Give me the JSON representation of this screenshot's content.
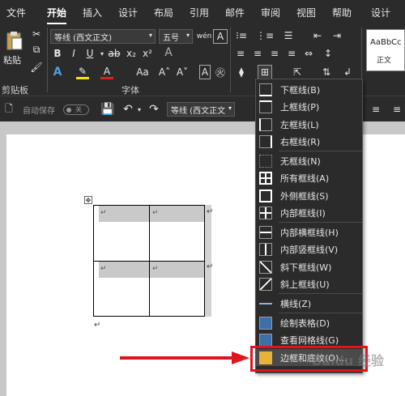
{
  "menubar": {
    "items": [
      "文件",
      "开始",
      "插入",
      "设计",
      "布局",
      "引用",
      "邮件",
      "审阅",
      "视图",
      "帮助",
      "设计"
    ],
    "active_index": 1
  },
  "ribbon": {
    "paste_label": "粘贴",
    "clipboard_label": "剪贴板",
    "font_group_label": "字体",
    "font_name": "等线 (西文正文)",
    "font_size": "五号",
    "style_preview": "AaBbCc",
    "style_name": "正文"
  },
  "qat": {
    "autosave_label": "自动保存",
    "autosave_state": "关",
    "font_name": "等线 (西文正文"
  },
  "dropdown": {
    "items": [
      {
        "label": "下框线(B)",
        "icon": "bottom-border-icon"
      },
      {
        "label": "上框线(P)",
        "icon": "top-border-icon"
      },
      {
        "label": "左框线(L)",
        "icon": "left-border-icon"
      },
      {
        "label": "右框线(R)",
        "icon": "right-border-icon"
      },
      {
        "label": "无框线(N)",
        "icon": "no-border-icon"
      },
      {
        "label": "所有框线(A)",
        "icon": "all-borders-icon"
      },
      {
        "label": "外侧框线(S)",
        "icon": "outside-borders-icon"
      },
      {
        "label": "内部框线(I)",
        "icon": "inside-borders-icon"
      },
      {
        "label": "内部横框线(H)",
        "icon": "inside-horizontal-border-icon"
      },
      {
        "label": "内部竖框线(V)",
        "icon": "inside-vertical-border-icon"
      },
      {
        "label": "斜下框线(W)",
        "icon": "diagonal-down-border-icon"
      },
      {
        "label": "斜上框线(U)",
        "icon": "diagonal-up-border-icon"
      },
      {
        "label": "横线(Z)",
        "icon": "horizontal-line-icon"
      },
      {
        "label": "绘制表格(D)",
        "icon": "draw-table-icon"
      },
      {
        "label": "查看网格线(G)",
        "icon": "view-gridlines-icon"
      },
      {
        "label": "边框和底纹(O)...",
        "icon": "borders-shading-icon"
      }
    ]
  },
  "document": {
    "cell_mark": "↵",
    "para_mark": "↵",
    "move_handle": "✥"
  },
  "watermark": "Baidu 经验",
  "colors": {
    "highlight_red": "#e0141d",
    "dark_ui": "#2b2b2b",
    "shade": "#c9c9c9"
  }
}
